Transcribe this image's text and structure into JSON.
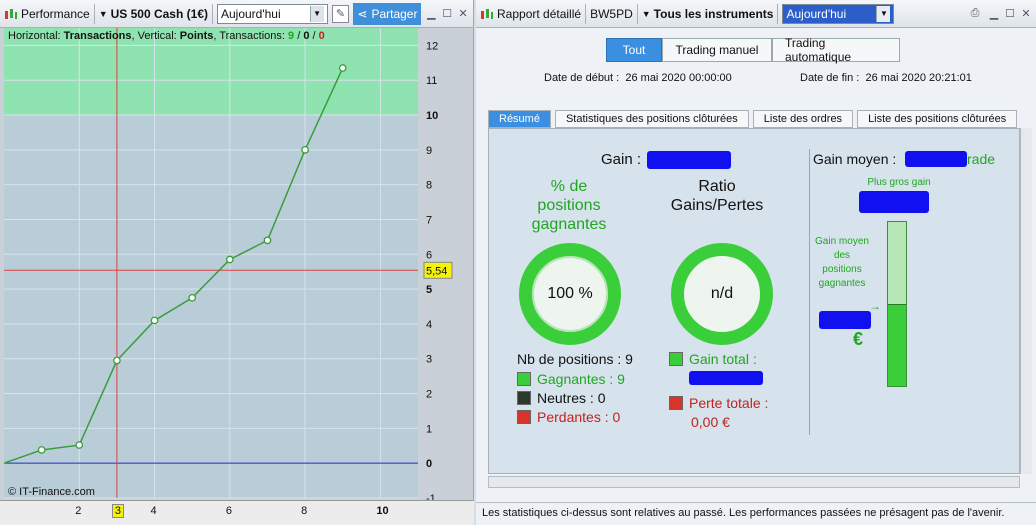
{
  "left": {
    "toolbar": {
      "performance": "Performance",
      "instrument": "US 500 Cash (1€)",
      "period": "Aujourd'hui",
      "share": "Partager"
    },
    "chart_info": {
      "prefix": "Horizontal: ",
      "h": "Transactions",
      "mid": ", Vertical: ",
      "v": "Points",
      "tx": ", Transactions: ",
      "n1": "9",
      "s1": " / ",
      "n2": "0",
      "s2": " / ",
      "n3": "0"
    },
    "price_badge": "5,54",
    "x_marker": "3",
    "credit": "© IT-Finance.com"
  },
  "chart_data": {
    "type": "line",
    "x": [
      0,
      1,
      2,
      3,
      4,
      5,
      6,
      7,
      8,
      9
    ],
    "y": [
      0,
      0.38,
      0.52,
      2.95,
      4.1,
      4.75,
      5.85,
      6.4,
      9.0,
      11.35
    ],
    "xlim": [
      0,
      11
    ],
    "ylim": [
      -1,
      12.5
    ],
    "yticks": [
      -1,
      0,
      1,
      2,
      3,
      4,
      5,
      6,
      7,
      8,
      9,
      10,
      11,
      12
    ],
    "xticks": [
      2,
      4,
      6,
      8,
      10
    ],
    "highlight_zone": [
      10,
      12.5
    ],
    "hline": 5.54,
    "vline": 3,
    "colors": {
      "line": "#3a9c3a",
      "zone": "#8fe3b0",
      "bg": "#b9cdd8",
      "hline": "#e04040",
      "vline": "#e04040",
      "zero": "#2222cc"
    }
  },
  "right": {
    "toolbar": {
      "report": "Rapport détaillé",
      "account": "BW5PD",
      "instruments": "Tous les instruments",
      "period": "Aujourd'hui"
    },
    "mode_tabs": [
      "Tout",
      "Trading manuel",
      "Trading automatique"
    ],
    "start_label": "Date de début :",
    "start_value": "26 mai 2020 00:00:00",
    "end_label": "Date de fin :",
    "end_value": "26 mai 2020 20:21:01",
    "tabs": [
      "Résumé",
      "Statistiques des positions clôturées",
      "Liste des ordres",
      "Liste des positions clôturées"
    ],
    "summary": {
      "gain_label": "Gain :",
      "win_pct_title": "% de positions gagnantes",
      "win_pct_value": "100 %",
      "ratio_title": "Ratio Gains/Pertes",
      "ratio_value": "n/d",
      "nb_positions": "Nb de positions : 9",
      "winners": "Gagnantes : 9",
      "neutral": "Neutres : 0",
      "losers": "Perdantes : 0",
      "gain_total": "Gain total :",
      "perte_totale": "Perte totale :",
      "perte_value": "0,00 €",
      "avg_gain_label": "Gain moyen :",
      "avg_gain_suffix": "rade",
      "biggest_gain": "Plus gros gain",
      "avg_winning": "Gain moyen des positions gagnantes",
      "euro": "€"
    },
    "status": "Les statistiques ci-dessus sont relatives au passé. Les performances passées ne présagent pas de l'avenir."
  }
}
